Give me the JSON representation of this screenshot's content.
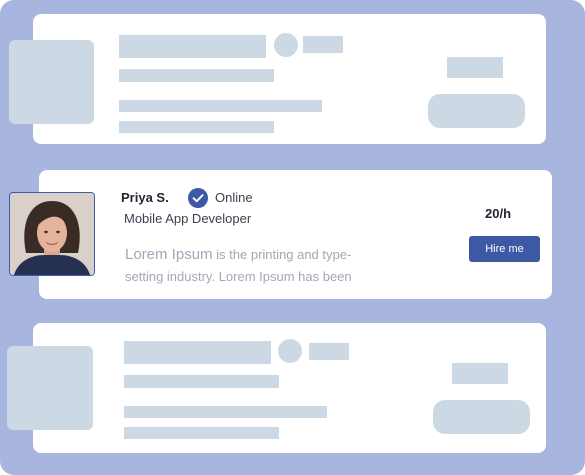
{
  "profile": {
    "name": "Priya S.",
    "status": "Online",
    "role": "Mobile App Developer",
    "description_lead": "Lorem Ipsum",
    "description_rest": " is the printing and type-setting industry. Lorem Ipsum has been",
    "rate": "20/h",
    "hire_label": "Hire me"
  },
  "icons": {
    "verified": "check-circle-icon"
  },
  "colors": {
    "frame_background": "#a7b5df",
    "skeleton": "#ccd8e3",
    "accent": "#3d59a4"
  }
}
